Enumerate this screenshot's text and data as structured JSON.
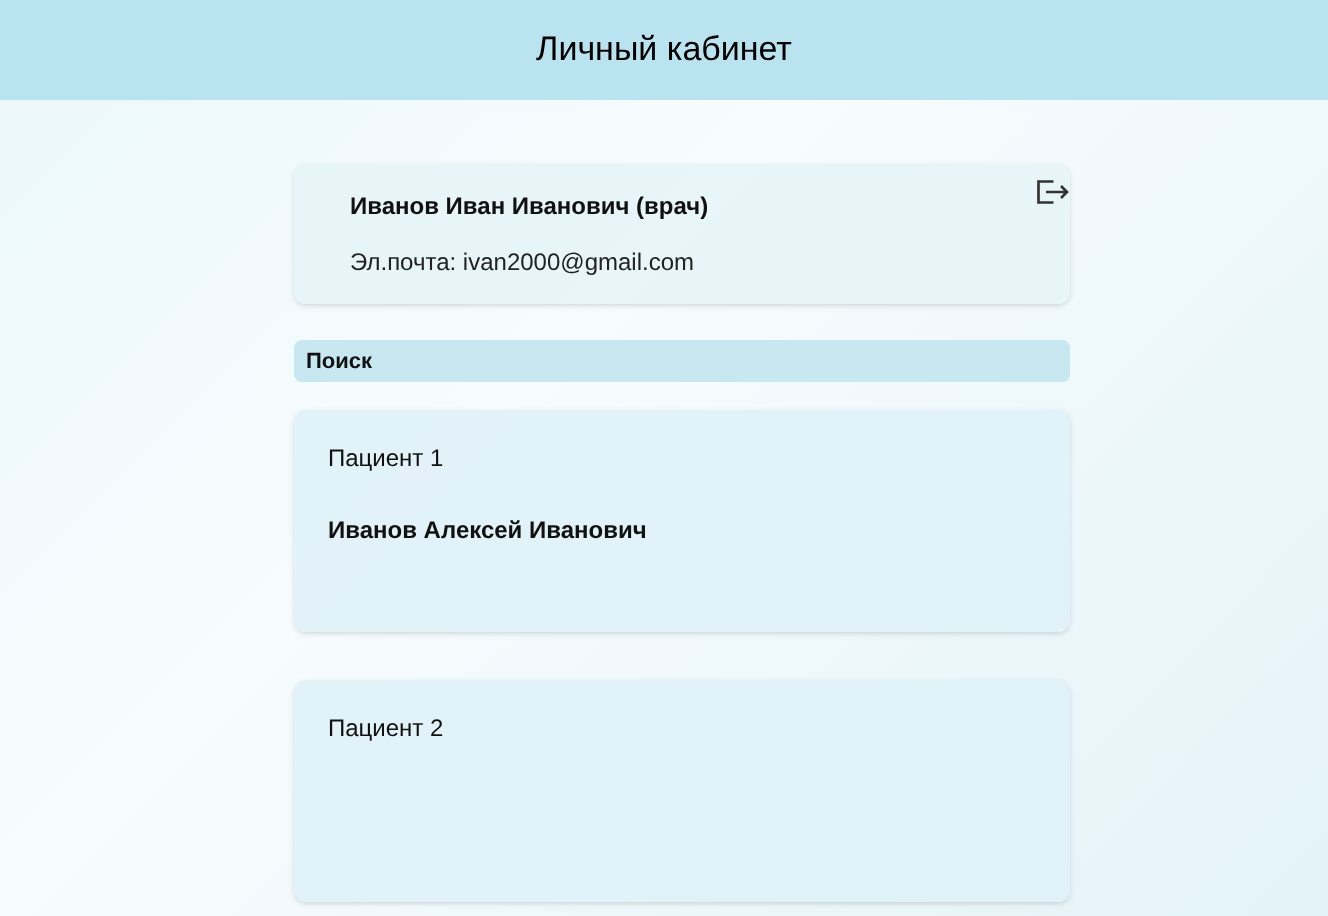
{
  "header": {
    "title": "Личный кабинет"
  },
  "profile": {
    "name": "Иванов Иван Иванович (врач)",
    "email": "Эл.почта: ivan2000@gmail.com"
  },
  "search": {
    "placeholder": "Поиск"
  },
  "patients": [
    {
      "title": "Пациент 1",
      "name": "Иванов Алексей Иванович"
    },
    {
      "title": "Пациент 2"
    }
  ]
}
